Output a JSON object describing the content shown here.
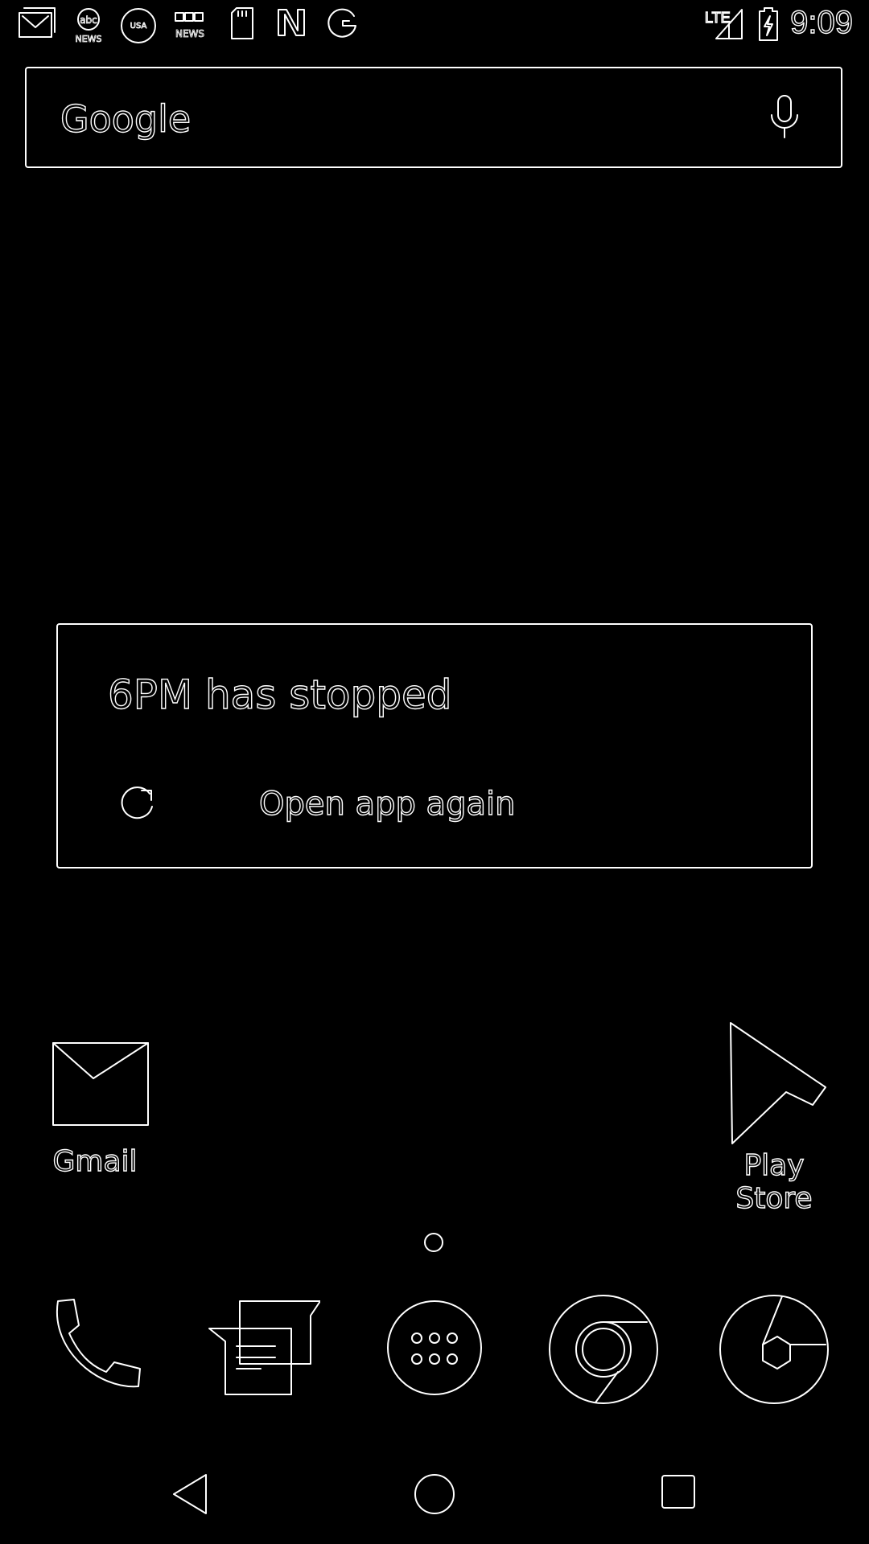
{
  "status_bar": {
    "time": "9:09",
    "network_label": "LTE",
    "notification_icons": [
      "gmail-icon",
      "abc-news-icon",
      "usa-today-icon",
      "bbc-news-icon",
      "sd-card-icon",
      "news-icon",
      "google-icon"
    ],
    "system_icons": [
      "signal-icon",
      "battery-charging-icon"
    ]
  },
  "search_bar": {
    "logo_text": "Google",
    "mic_icon": "mic-icon"
  },
  "dialog": {
    "title": "6PM has stopped",
    "action_label": "Open app again",
    "action_icon": "refresh-icon"
  },
  "home_apps": [
    {
      "label": "Gmail",
      "icon": "gmail-icon"
    },
    {
      "label": "Play Store",
      "icon": "play-store-icon"
    }
  ],
  "dock": [
    {
      "icon": "phone-icon"
    },
    {
      "icon": "messages-icon"
    },
    {
      "icon": "app-drawer-icon"
    },
    {
      "icon": "chrome-icon"
    },
    {
      "icon": "camera-icon"
    }
  ],
  "nav_bar": [
    "back-icon",
    "home-icon",
    "recents-icon"
  ]
}
